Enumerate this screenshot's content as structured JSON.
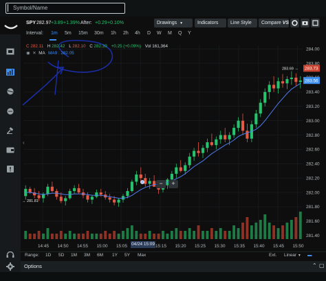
{
  "search": {
    "value": "Symbol/Name"
  },
  "symbol": {
    "ticker": "SPY",
    "price": "282.97",
    "change": "+3.89",
    "change_pct": "+1.39%",
    "after_label": "After:",
    "after_change": "+0.29",
    "after_pct": "+0.10%"
  },
  "toolbar": {
    "drawings": "Drawings",
    "indicators": "Indicators",
    "line_style": "Line Style",
    "compare": "Compare",
    "compare_vs": "VS"
  },
  "intervals": {
    "label": "Interval:",
    "items": [
      "1m",
      "5m",
      "15m",
      "30m",
      "1h",
      "2h",
      "4h",
      "D",
      "W",
      "M",
      "Q",
      "Y"
    ],
    "active": "1m"
  },
  "legend": {
    "c_label": "C",
    "c": "282.11",
    "h_label": "H",
    "h": "282.42",
    "l_label": "L",
    "l": "282.10",
    "c2_label": "C",
    "c2": "282.39",
    "chg": "+0.25 (+0.09%)",
    "vol_label": "Vol",
    "vol": "161,364",
    "ma_label": "MA",
    "ma_value": "MA9 : 282.05"
  },
  "chart_data": {
    "type": "candlestick",
    "y_ticks": [
      "284.00",
      "283.80",
      "283.60",
      "283.40",
      "283.20",
      "283.00",
      "282.80",
      "282.60",
      "282.40",
      "282.20",
      "282.00",
      "281.80",
      "281.60",
      "281.40"
    ],
    "x_ticks": [
      "14:45",
      "14:50",
      "14:55",
      "15:00",
      "15:05",
      "15:10",
      "15:15",
      "15:20",
      "15:25",
      "15:30",
      "15:35",
      "15:40",
      "15:45",
      "15:50"
    ],
    "ylim": [
      281.35,
      284.05
    ],
    "price_tag": "283.73",
    "price_tag2": "283.56",
    "high_marker": "283.69",
    "low_marker": "281.81",
    "crosshair_time": "04/24 15:09",
    "up_color": "#27c26d",
    "down_color": "#e35a45",
    "ma_color": "#4f7df0",
    "candles": [
      [
        281.95,
        282.1,
        281.9,
        282.05
      ],
      [
        282.05,
        282.08,
        281.98,
        282.0
      ],
      [
        282.0,
        282.06,
        281.92,
        281.96
      ],
      [
        281.96,
        282.02,
        281.88,
        281.92
      ],
      [
        281.92,
        282.0,
        281.86,
        281.98
      ],
      [
        281.98,
        282.12,
        281.95,
        282.08
      ],
      [
        282.08,
        282.15,
        282.0,
        282.02
      ],
      [
        282.02,
        282.05,
        281.9,
        281.94
      ],
      [
        281.94,
        282.0,
        281.85,
        281.88
      ],
      [
        281.88,
        281.95,
        281.82,
        281.92
      ],
      [
        281.92,
        282.05,
        281.9,
        282.02
      ],
      [
        282.02,
        282.1,
        281.98,
        282.06
      ],
      [
        282.06,
        282.12,
        281.98,
        282.0
      ],
      [
        282.0,
        282.05,
        281.92,
        281.96
      ],
      [
        281.96,
        282.0,
        281.86,
        281.9
      ],
      [
        281.9,
        281.96,
        281.84,
        281.94
      ],
      [
        281.94,
        282.04,
        281.92,
        282.0
      ],
      [
        282.0,
        282.05,
        281.94,
        281.97
      ],
      [
        281.97,
        282.02,
        281.9,
        281.93
      ],
      [
        281.93,
        281.98,
        281.86,
        281.9
      ],
      [
        281.9,
        281.95,
        281.82,
        281.86
      ],
      [
        281.86,
        281.92,
        281.8,
        281.9
      ],
      [
        281.9,
        281.98,
        281.86,
        281.95
      ],
      [
        281.95,
        282.06,
        281.92,
        282.02
      ],
      [
        282.02,
        282.18,
        282.0,
        282.15
      ],
      [
        282.15,
        282.3,
        282.1,
        282.25
      ],
      [
        282.25,
        282.35,
        282.15,
        282.2
      ],
      [
        282.2,
        282.26,
        282.08,
        282.12
      ],
      [
        282.12,
        282.2,
        282.05,
        282.16
      ],
      [
        282.16,
        282.24,
        282.1,
        282.08
      ],
      [
        282.08,
        282.14,
        281.98,
        282.04
      ],
      [
        282.04,
        282.12,
        282.0,
        282.1
      ],
      [
        282.1,
        282.2,
        282.05,
        282.18
      ],
      [
        282.18,
        282.3,
        282.14,
        282.26
      ],
      [
        282.26,
        282.4,
        282.2,
        282.35
      ],
      [
        282.35,
        282.45,
        282.28,
        282.3
      ],
      [
        282.3,
        282.42,
        282.25,
        282.38
      ],
      [
        282.38,
        282.55,
        282.34,
        282.5
      ],
      [
        282.5,
        282.62,
        282.44,
        282.58
      ],
      [
        282.58,
        282.7,
        282.5,
        282.55
      ],
      [
        282.55,
        282.66,
        282.48,
        282.62
      ],
      [
        282.62,
        282.75,
        282.56,
        282.7
      ],
      [
        282.7,
        282.82,
        282.64,
        282.66
      ],
      [
        282.66,
        282.78,
        282.6,
        282.74
      ],
      [
        282.74,
        282.86,
        282.68,
        282.8
      ],
      [
        282.8,
        282.9,
        282.7,
        282.74
      ],
      [
        282.74,
        282.84,
        282.66,
        282.8
      ],
      [
        282.8,
        282.95,
        282.76,
        282.9
      ],
      [
        282.9,
        283.05,
        282.85,
        283.0
      ],
      [
        283.0,
        283.1,
        282.8,
        282.86
      ],
      [
        282.86,
        282.96,
        282.7,
        282.75
      ],
      [
        282.75,
        283.0,
        282.7,
        282.95
      ],
      [
        282.95,
        283.15,
        282.9,
        283.1
      ],
      [
        283.1,
        283.3,
        283.05,
        283.25
      ],
      [
        283.25,
        283.45,
        283.2,
        283.4
      ],
      [
        283.4,
        283.55,
        283.3,
        283.5
      ],
      [
        283.5,
        283.62,
        283.4,
        283.45
      ],
      [
        283.45,
        283.6,
        283.38,
        283.55
      ],
      [
        283.55,
        283.65,
        283.46,
        283.52
      ],
      [
        283.52,
        283.62,
        283.44,
        283.58
      ],
      [
        283.58,
        283.69,
        283.5,
        283.6
      ],
      [
        283.6,
        283.66,
        283.48,
        283.54
      ],
      [
        283.54,
        283.62,
        283.45,
        283.56
      ]
    ],
    "ma9": [
      282.0,
      282.0,
      281.99,
      281.98,
      281.97,
      281.98,
      281.99,
      281.99,
      281.98,
      281.97,
      281.97,
      281.98,
      281.98,
      281.98,
      281.97,
      281.96,
      281.96,
      281.96,
      281.95,
      281.94,
      281.93,
      281.92,
      281.92,
      281.93,
      281.96,
      282.0,
      282.04,
      282.07,
      282.09,
      282.11,
      282.12,
      282.13,
      282.14,
      282.16,
      282.19,
      282.22,
      282.26,
      282.31,
      282.36,
      282.4,
      282.44,
      282.49,
      282.54,
      282.58,
      282.62,
      282.66,
      282.69,
      282.73,
      282.78,
      282.81,
      282.83,
      282.85,
      282.88,
      282.93,
      283.0,
      283.08,
      283.16,
      283.24,
      283.31,
      283.38,
      283.44,
      283.48,
      283.52
    ],
    "volume": [
      3,
      2,
      2,
      3,
      2,
      4,
      2,
      2,
      3,
      2,
      3,
      2,
      2,
      2,
      3,
      2,
      2,
      2,
      3,
      2,
      3,
      2,
      3,
      4,
      5,
      3,
      2,
      2,
      3,
      2,
      2,
      3,
      2,
      3,
      4,
      3,
      3,
      4,
      3,
      5,
      3,
      3,
      4,
      3,
      4,
      3,
      3,
      5,
      4,
      6,
      8,
      5,
      6,
      7,
      9,
      6,
      5,
      4,
      5,
      6,
      7,
      8,
      10
    ]
  },
  "zoom": {
    "minus": "−",
    "plus": "+"
  },
  "range": {
    "label": "Range:",
    "items": [
      "1D",
      "5D",
      "1M",
      "3M",
      "6M",
      "1Y",
      "5Y",
      "Max"
    ],
    "ext": "Ext.",
    "linear": "Linear"
  },
  "options": {
    "label": "Options"
  },
  "colors": {
    "accent": "#3d8ff0",
    "background": "#0e0e0e",
    "sidebar": "#161a1c"
  }
}
